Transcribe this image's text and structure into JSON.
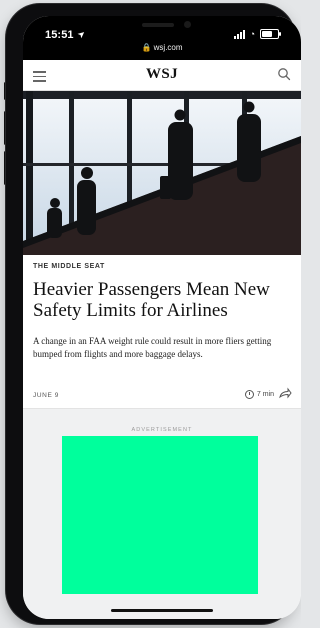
{
  "status_bar": {
    "time": "15:51",
    "url": "wsj.com",
    "icons": [
      "location-arrow-icon",
      "signal-icon",
      "wifi-icon",
      "battery-icon"
    ]
  },
  "nav": {
    "logo": "WSJ",
    "icons": [
      "hamburger-menu-icon",
      "search-icon"
    ]
  },
  "article": {
    "section": "THE MIDDLE SEAT",
    "headline": "Heavier Passengers Mean New Safety Limits for Airlines",
    "summary": "A change in an FAA weight rule could result in more fliers getting bumped from flights and more baggage delays.",
    "date": "JUNE 9",
    "read_time": "7 min",
    "icons": [
      "clock-icon",
      "share-icon"
    ]
  },
  "ad": {
    "label": "ADVERTISEMENT",
    "color": "#00ff9c"
  },
  "colors": {
    "accent": "#00ff9c",
    "text": "#111111",
    "status_bar": "#000000"
  }
}
